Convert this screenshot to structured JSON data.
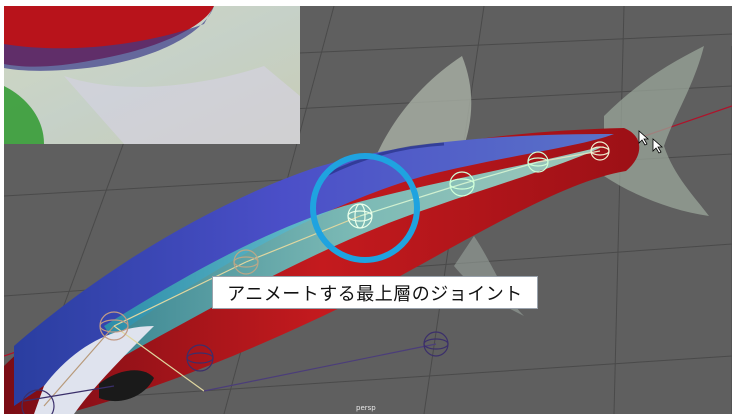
{
  "annotation": {
    "label": "アニメートする最上層のジョイント"
  },
  "viewport": {
    "camera_label": "persp"
  },
  "highlight": {
    "color": "#1fa3e0",
    "target": "top-level-joint"
  },
  "colors": {
    "grid_background": "#5f5f5f",
    "grid_line": "#4a4a4a",
    "axis_line": "#b0122a",
    "fish_red": "#b3141c",
    "fish_blue": "#3d42b5",
    "joint_green": "#bfffd0",
    "joint_purple": "#3b2f6b"
  },
  "icons": [
    "cursor-icon",
    "camera-icon"
  ]
}
